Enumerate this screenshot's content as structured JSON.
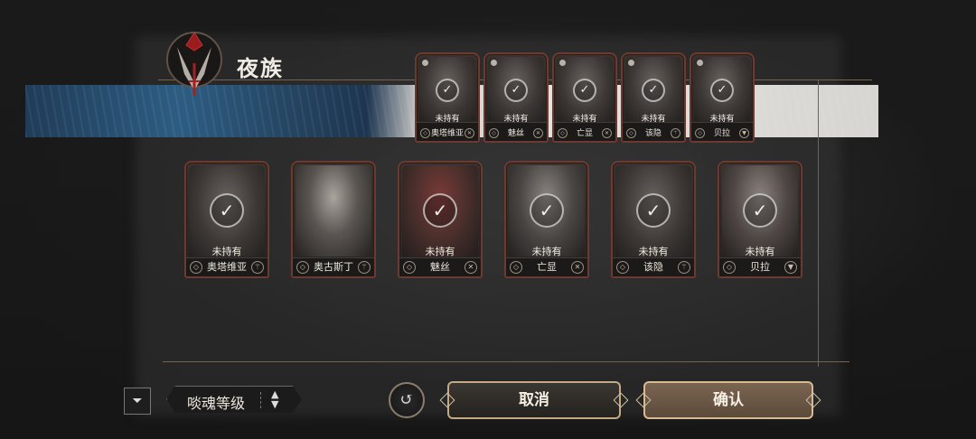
{
  "header": {
    "title": "夜族",
    "emblem_icon": "nightclan-crest-icon"
  },
  "selected_cards": [
    {
      "status": "未持有",
      "name": "奥塔维亚"
    },
    {
      "status": "未持有",
      "name": "魅丝"
    },
    {
      "status": "未持有",
      "name": "亡显"
    },
    {
      "status": "未持有",
      "name": "该隐"
    },
    {
      "status": "未持有",
      "name": "贝拉"
    }
  ],
  "roster_cards": [
    {
      "status": "未持有",
      "name": "奥塔维亚"
    },
    {
      "status": "",
      "name": "奥古斯丁"
    },
    {
      "status": "未持有",
      "name": "魅丝"
    },
    {
      "status": "未持有",
      "name": "亡显"
    },
    {
      "status": "未持有",
      "name": "该隐"
    },
    {
      "status": "未持有",
      "name": "贝拉"
    }
  ],
  "toolbar": {
    "filter_icon": "filter-icon",
    "sort_label": "啖魂等级",
    "reset_icon": "reset-icon",
    "cancel_label": "取消",
    "confirm_label": "确认"
  }
}
